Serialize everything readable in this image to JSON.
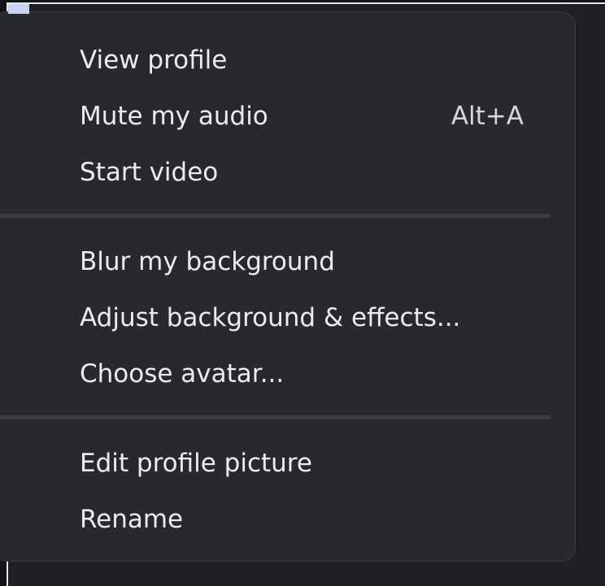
{
  "menu": {
    "groups": [
      {
        "items": [
          {
            "label": "View profile",
            "shortcut": ""
          },
          {
            "label": "Mute my audio",
            "shortcut": "Alt+A"
          },
          {
            "label": "Start video",
            "shortcut": ""
          }
        ]
      },
      {
        "items": [
          {
            "label": "Blur my background",
            "shortcut": ""
          },
          {
            "label": "Adjust background & effects...",
            "shortcut": ""
          },
          {
            "label": "Choose avatar...",
            "shortcut": ""
          }
        ]
      },
      {
        "items": [
          {
            "label": "Edit profile picture",
            "shortcut": ""
          },
          {
            "label": "Rename",
            "shortcut": ""
          }
        ]
      }
    ]
  },
  "colors": {
    "menu_background": "#28292d",
    "text": "#ececed",
    "separator": "#3b3c41"
  }
}
